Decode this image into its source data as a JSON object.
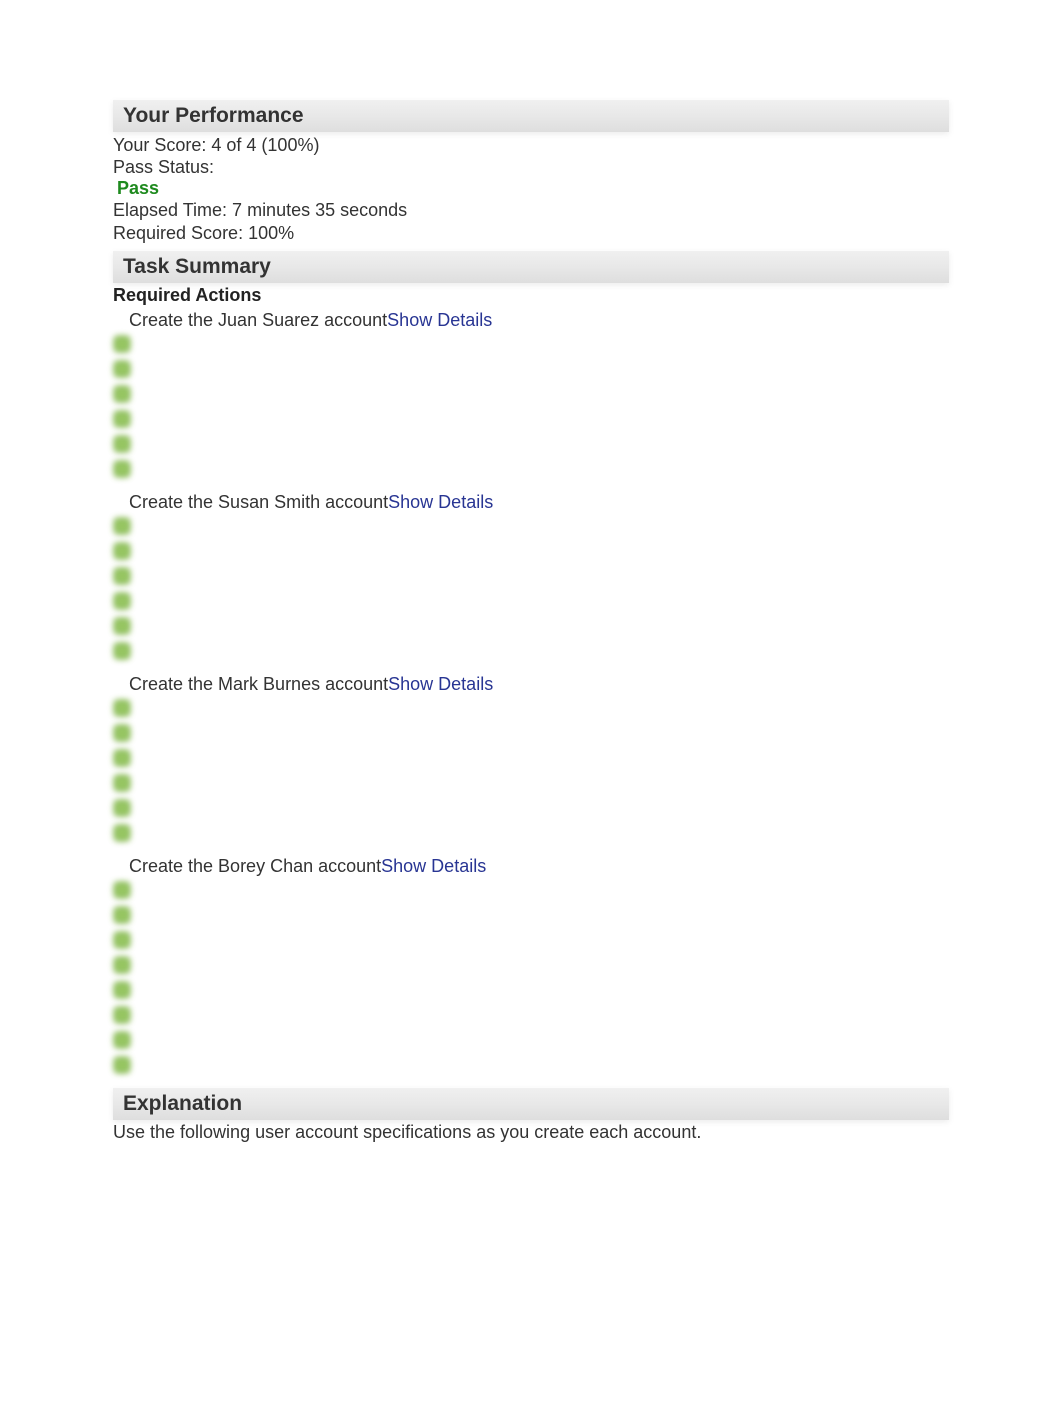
{
  "performance": {
    "header": "Your Performance",
    "score_line": "Your Score: 4 of 4 (100%)",
    "pass_label": "Pass Status:",
    "pass_value": "Pass",
    "elapsed": "Elapsed Time: 7 minutes 35 seconds",
    "required": "Required Score: 100%"
  },
  "task_summary": {
    "header": "Task Summary",
    "required_heading": "Required Actions",
    "show_details_label": "Show Details",
    "actions": [
      {
        "text": "Create the Juan Suarez account",
        "subcount": 6
      },
      {
        "text": "Create the Susan Smith account",
        "subcount": 6
      },
      {
        "text": "Create the Mark Burnes account",
        "subcount": 6
      },
      {
        "text": "Create the Borey Chan account",
        "subcount": 8
      }
    ]
  },
  "explanation": {
    "header": "Explanation",
    "text": "Use the following user account specifications as you create each account."
  }
}
